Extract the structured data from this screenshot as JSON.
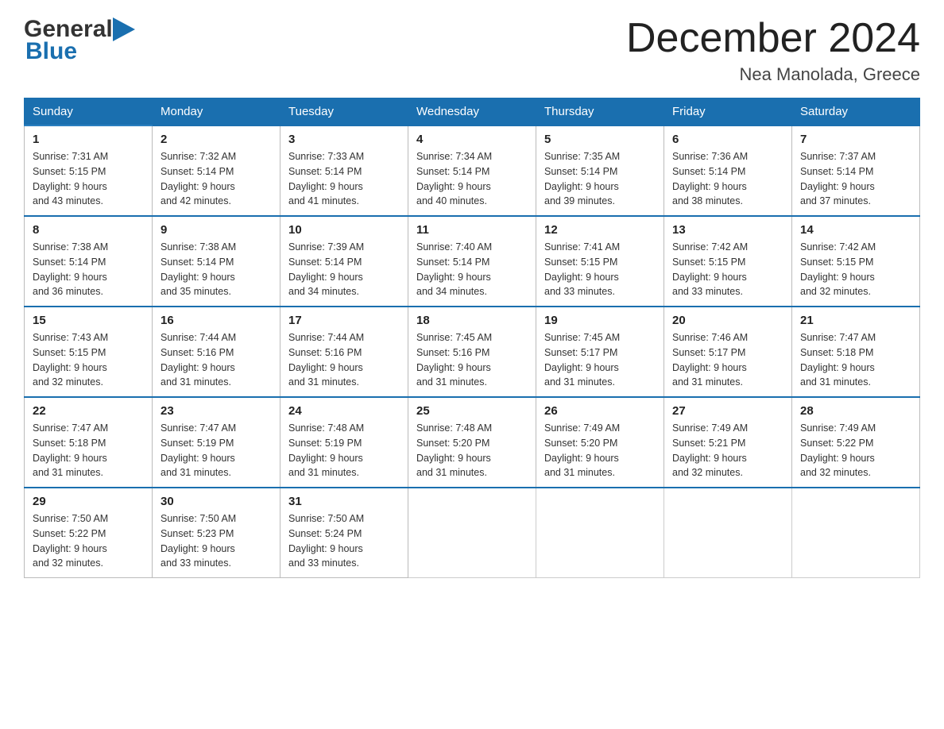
{
  "header": {
    "title": "December 2024",
    "subtitle": "Nea Manolada, Greece",
    "logo_general": "General",
    "logo_blue": "Blue"
  },
  "days_of_week": [
    "Sunday",
    "Monday",
    "Tuesday",
    "Wednesday",
    "Thursday",
    "Friday",
    "Saturday"
  ],
  "weeks": [
    [
      {
        "day": "1",
        "sunrise": "7:31 AM",
        "sunset": "5:15 PM",
        "daylight": "9 hours and 43 minutes."
      },
      {
        "day": "2",
        "sunrise": "7:32 AM",
        "sunset": "5:14 PM",
        "daylight": "9 hours and 42 minutes."
      },
      {
        "day": "3",
        "sunrise": "7:33 AM",
        "sunset": "5:14 PM",
        "daylight": "9 hours and 41 minutes."
      },
      {
        "day": "4",
        "sunrise": "7:34 AM",
        "sunset": "5:14 PM",
        "daylight": "9 hours and 40 minutes."
      },
      {
        "day": "5",
        "sunrise": "7:35 AM",
        "sunset": "5:14 PM",
        "daylight": "9 hours and 39 minutes."
      },
      {
        "day": "6",
        "sunrise": "7:36 AM",
        "sunset": "5:14 PM",
        "daylight": "9 hours and 38 minutes."
      },
      {
        "day": "7",
        "sunrise": "7:37 AM",
        "sunset": "5:14 PM",
        "daylight": "9 hours and 37 minutes."
      }
    ],
    [
      {
        "day": "8",
        "sunrise": "7:38 AM",
        "sunset": "5:14 PM",
        "daylight": "9 hours and 36 minutes."
      },
      {
        "day": "9",
        "sunrise": "7:38 AM",
        "sunset": "5:14 PM",
        "daylight": "9 hours and 35 minutes."
      },
      {
        "day": "10",
        "sunrise": "7:39 AM",
        "sunset": "5:14 PM",
        "daylight": "9 hours and 34 minutes."
      },
      {
        "day": "11",
        "sunrise": "7:40 AM",
        "sunset": "5:14 PM",
        "daylight": "9 hours and 34 minutes."
      },
      {
        "day": "12",
        "sunrise": "7:41 AM",
        "sunset": "5:15 PM",
        "daylight": "9 hours and 33 minutes."
      },
      {
        "day": "13",
        "sunrise": "7:42 AM",
        "sunset": "5:15 PM",
        "daylight": "9 hours and 33 minutes."
      },
      {
        "day": "14",
        "sunrise": "7:42 AM",
        "sunset": "5:15 PM",
        "daylight": "9 hours and 32 minutes."
      }
    ],
    [
      {
        "day": "15",
        "sunrise": "7:43 AM",
        "sunset": "5:15 PM",
        "daylight": "9 hours and 32 minutes."
      },
      {
        "day": "16",
        "sunrise": "7:44 AM",
        "sunset": "5:16 PM",
        "daylight": "9 hours and 31 minutes."
      },
      {
        "day": "17",
        "sunrise": "7:44 AM",
        "sunset": "5:16 PM",
        "daylight": "9 hours and 31 minutes."
      },
      {
        "day": "18",
        "sunrise": "7:45 AM",
        "sunset": "5:16 PM",
        "daylight": "9 hours and 31 minutes."
      },
      {
        "day": "19",
        "sunrise": "7:45 AM",
        "sunset": "5:17 PM",
        "daylight": "9 hours and 31 minutes."
      },
      {
        "day": "20",
        "sunrise": "7:46 AM",
        "sunset": "5:17 PM",
        "daylight": "9 hours and 31 minutes."
      },
      {
        "day": "21",
        "sunrise": "7:47 AM",
        "sunset": "5:18 PM",
        "daylight": "9 hours and 31 minutes."
      }
    ],
    [
      {
        "day": "22",
        "sunrise": "7:47 AM",
        "sunset": "5:18 PM",
        "daylight": "9 hours and 31 minutes."
      },
      {
        "day": "23",
        "sunrise": "7:47 AM",
        "sunset": "5:19 PM",
        "daylight": "9 hours and 31 minutes."
      },
      {
        "day": "24",
        "sunrise": "7:48 AM",
        "sunset": "5:19 PM",
        "daylight": "9 hours and 31 minutes."
      },
      {
        "day": "25",
        "sunrise": "7:48 AM",
        "sunset": "5:20 PM",
        "daylight": "9 hours and 31 minutes."
      },
      {
        "day": "26",
        "sunrise": "7:49 AM",
        "sunset": "5:20 PM",
        "daylight": "9 hours and 31 minutes."
      },
      {
        "day": "27",
        "sunrise": "7:49 AM",
        "sunset": "5:21 PM",
        "daylight": "9 hours and 32 minutes."
      },
      {
        "day": "28",
        "sunrise": "7:49 AM",
        "sunset": "5:22 PM",
        "daylight": "9 hours and 32 minutes."
      }
    ],
    [
      {
        "day": "29",
        "sunrise": "7:50 AM",
        "sunset": "5:22 PM",
        "daylight": "9 hours and 32 minutes."
      },
      {
        "day": "30",
        "sunrise": "7:50 AM",
        "sunset": "5:23 PM",
        "daylight": "9 hours and 33 minutes."
      },
      {
        "day": "31",
        "sunrise": "7:50 AM",
        "sunset": "5:24 PM",
        "daylight": "9 hours and 33 minutes."
      },
      null,
      null,
      null,
      null
    ]
  ],
  "labels": {
    "sunrise": "Sunrise:",
    "sunset": "Sunset:",
    "daylight": "Daylight:"
  }
}
